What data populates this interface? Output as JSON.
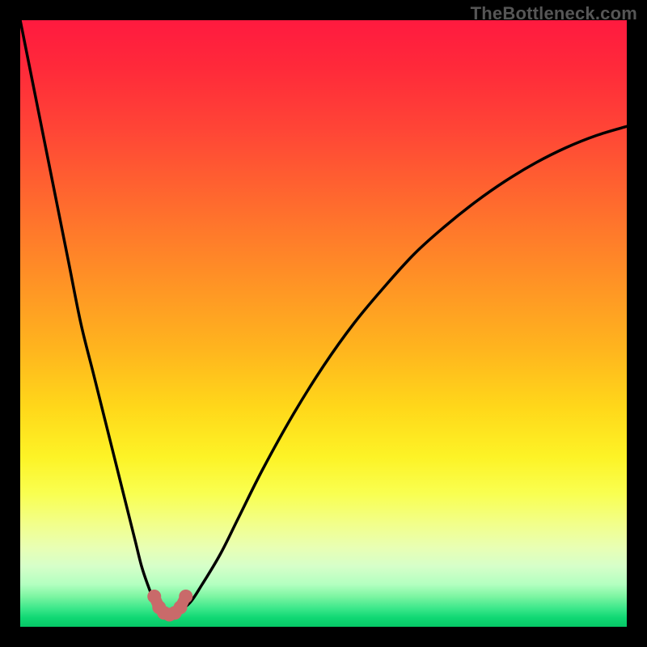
{
  "watermark": {
    "text": "TheBottleneck.com"
  },
  "colors": {
    "curve_stroke": "#000000",
    "marker_fill": "#c96a6a",
    "marker_stroke": "#c96a6a"
  },
  "chart_data": {
    "type": "line",
    "title": "",
    "xlabel": "",
    "ylabel": "",
    "xlim": [
      0,
      100
    ],
    "ylim": [
      0,
      100
    ],
    "grid": false,
    "legend": false,
    "series": [
      {
        "name": "bottleneck-curve",
        "x": [
          0,
          2,
          4,
          6,
          8,
          10,
          12,
          14,
          16,
          18,
          19,
          20,
          21,
          22,
          23,
          24,
          25,
          26,
          28,
          30,
          33,
          36,
          40,
          45,
          50,
          55,
          60,
          65,
          70,
          75,
          80,
          85,
          90,
          95,
          100
        ],
        "y": [
          100,
          90,
          80,
          70,
          60,
          50,
          42,
          34,
          26,
          18,
          14,
          10,
          7,
          4.5,
          3,
          2.2,
          2,
          2.5,
          4,
          7,
          12,
          18,
          26,
          35,
          43,
          50,
          56,
          61.5,
          66,
          70,
          73.5,
          76.5,
          79,
          81,
          82.5
        ]
      }
    ],
    "markers": [
      {
        "x": 22.1,
        "y": 5.0
      },
      {
        "x": 22.9,
        "y": 3.2
      },
      {
        "x": 23.7,
        "y": 2.3
      },
      {
        "x": 24.6,
        "y": 2.0
      },
      {
        "x": 25.5,
        "y": 2.3
      },
      {
        "x": 26.4,
        "y": 3.2
      },
      {
        "x": 27.3,
        "y": 5.0
      }
    ]
  }
}
